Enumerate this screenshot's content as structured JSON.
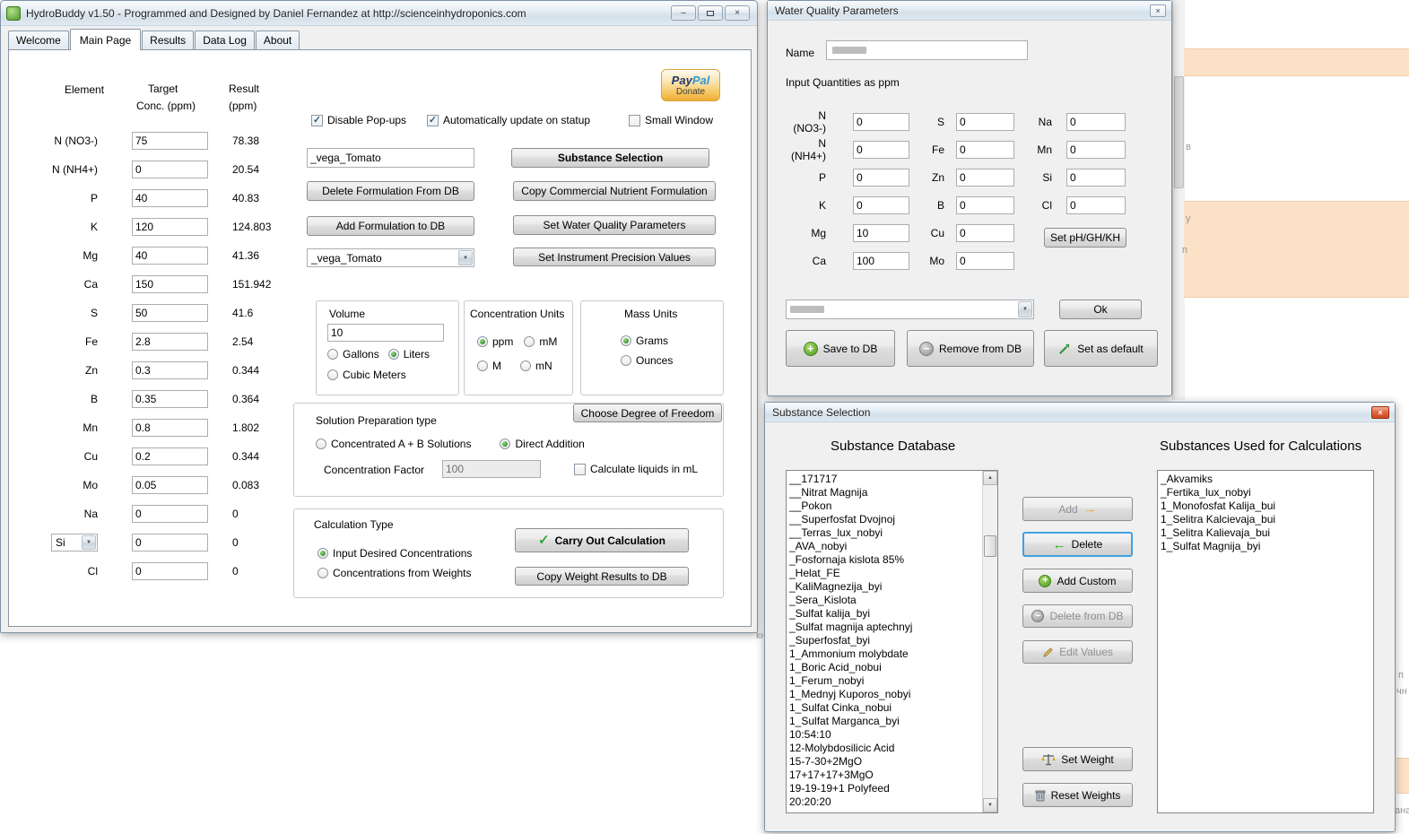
{
  "background": {
    "fragments": [
      {
        "text": "в"
      },
      {
        "text": "у"
      },
      {
        "text": "п"
      },
      {
        "text": "кно"
      },
      {
        "text": "п"
      },
      {
        "text": "чн"
      },
      {
        "text": "ана"
      }
    ]
  },
  "main_window": {
    "title": "HydroBuddy v1.50 - Programmed and Designed by Daniel Fernandez at http://scienceinhydroponics.com",
    "tabs": [
      {
        "label": "Welcome",
        "active": false
      },
      {
        "label": "Main Page",
        "active": true
      },
      {
        "label": "Results",
        "active": false
      },
      {
        "label": "Data Log",
        "active": false
      },
      {
        "label": "About",
        "active": false
      }
    ],
    "table": {
      "col_element": "Element",
      "col_target_line1": "Target",
      "col_target_line2": "Conc. (ppm)",
      "col_result_line1": "Result",
      "col_result_line2": "(ppm)",
      "rows": [
        {
          "element": "N (NO3-)",
          "target": "75",
          "result": "78.38"
        },
        {
          "element": "N (NH4+)",
          "target": "0",
          "result": "20.54"
        },
        {
          "element": "P",
          "target": "40",
          "result": "40.83"
        },
        {
          "element": "K",
          "target": "120",
          "result": "124.803"
        },
        {
          "element": "Mg",
          "target": "40",
          "result": "41.36"
        },
        {
          "element": "Ca",
          "target": "150",
          "result": "151.942"
        },
        {
          "element": "S",
          "target": "50",
          "result": "41.6"
        },
        {
          "element": "Fe",
          "target": "2.8",
          "result": "2.54"
        },
        {
          "element": "Zn",
          "target": "0.3",
          "result": "0.344"
        },
        {
          "element": "B",
          "target": "0.35",
          "result": "0.364"
        },
        {
          "element": "Mn",
          "target": "0.8",
          "result": "1.802"
        },
        {
          "element": "Cu",
          "target": "0.2",
          "result": "0.344"
        },
        {
          "element": "Mo",
          "target": "0.05",
          "result": "0.083"
        },
        {
          "element": "Na",
          "target": "0",
          "result": "0"
        },
        {
          "element": "Si",
          "target": "0",
          "result": "0",
          "si_select": true
        },
        {
          "element": "Cl",
          "target": "0",
          "result": "0"
        }
      ]
    },
    "options": {
      "disable_popups": {
        "label": "Disable Pop-ups",
        "checked": true
      },
      "auto_update": {
        "label": "Automatically update on statup",
        "checked": true
      },
      "small_window": {
        "label": "Small Window",
        "checked": false
      }
    },
    "formulation_name_input": "_vega_Tomato",
    "formulation_dropdown_value": "_vega_Tomato",
    "buttons": {
      "substance_selection": "Substance Selection",
      "delete_formulation": "Delete Formulation From DB",
      "copy_commercial": "Copy Commercial Nutrient Formulation",
      "add_formulation": "Add Formulation to DB",
      "set_water_quality": "Set Water Quality Parameters",
      "set_instrument": "Set Instrument Precision Values",
      "choose_degree": "Choose Degree of Freedom",
      "carry_out": "Carry Out Calculation",
      "copy_weights": "Copy Weight Results to DB"
    },
    "paypal": {
      "brand_pay": "Pay",
      "brand_pal": "Pal",
      "label": "Donate"
    },
    "volume": {
      "title": "Volume",
      "value": "10",
      "options": [
        {
          "label": "Gallons",
          "selected": false
        },
        {
          "label": "Liters",
          "selected": true
        },
        {
          "label": "Cubic Meters",
          "selected": false
        }
      ]
    },
    "concentration_units": {
      "title": "Concentration Units",
      "options": [
        {
          "label": "ppm",
          "selected": true
        },
        {
          "label": "mM",
          "selected": false
        },
        {
          "label": "M",
          "selected": false
        },
        {
          "label": "mN",
          "selected": false
        }
      ]
    },
    "mass_units": {
      "title": "Mass Units",
      "options": [
        {
          "label": "Grams",
          "selected": true
        },
        {
          "label": "Ounces",
          "selected": false
        }
      ]
    },
    "solution_prep": {
      "title": "Solution Preparation type",
      "options": [
        {
          "label": "Concentrated A + B Solutions",
          "selected": false
        },
        {
          "label": "Direct Addition",
          "selected": true
        }
      ],
      "concentration_factor_label": "Concentration Factor",
      "concentration_factor_value": "100",
      "calc_liquids": {
        "label": "Calculate liquids in mL",
        "checked": false
      }
    },
    "calculation_type": {
      "title": "Calculation Type",
      "options": [
        {
          "label": "Input Desired Concentrations",
          "selected": true
        },
        {
          "label": "Concentrations from Weights",
          "selected": false
        }
      ]
    }
  },
  "water_quality_window": {
    "title": "Water Quality Parameters",
    "name_label": "Name",
    "subtitle": "Input Quantities as ppm",
    "col1": [
      {
        "label": "N (NO3-)",
        "value": "0"
      },
      {
        "label": "N (NH4+)",
        "value": "0"
      },
      {
        "label": "P",
        "value": "0"
      },
      {
        "label": "K",
        "value": "0"
      },
      {
        "label": "Mg",
        "value": "10"
      },
      {
        "label": "Ca",
        "value": "100"
      }
    ],
    "col2": [
      {
        "label": "S",
        "value": "0"
      },
      {
        "label": "Fe",
        "value": "0"
      },
      {
        "label": "Zn",
        "value": "0"
      },
      {
        "label": "B",
        "value": "0"
      },
      {
        "label": "Cu",
        "value": "0"
      },
      {
        "label": "Mo",
        "value": "0"
      }
    ],
    "col3": [
      {
        "label": "Na",
        "value": "0"
      },
      {
        "label": "Mn",
        "value": "0"
      },
      {
        "label": "Si",
        "value": "0"
      },
      {
        "label": "Cl",
        "value": "0"
      }
    ],
    "buttons": {
      "set_ph": "Set pH/GH/KH",
      "ok": "Ok",
      "save": "Save to DB",
      "remove": "Remove from  DB",
      "set_default": "Set as default"
    }
  },
  "substance_window": {
    "title": "Substance Selection",
    "database_heading": "Substance Database",
    "used_heading": "Substances Used for Calculations",
    "database_items": [
      "__171717",
      "__Nitrat Magnija",
      "__Pokon",
      "__Superfosfat Dvojnoj",
      "__Terras_lux_nobyi",
      "_AVA_nobyi",
      "_Fosfornaja kislota 85%",
      "_Helat_FE",
      "_KaliMagnezija_byi",
      "_Sera_Kislota",
      "_Sulfat kalija_byi",
      "_Sulfat magnija aptechnyj",
      "_Superfosfat_byi",
      "1_Ammonium molybdate",
      "1_Boric Acid_nobui",
      "1_Ferum_nobyi",
      "1_Mednyj Kuporos_nobyi",
      "1_Sulfat Cinka_nobui",
      "1_Sulfat Marganca_byi",
      "10:54:10",
      "12-Molybdosilicic Acid",
      "15-7-30+2MgO",
      "17+17+17+3MgO",
      "19-19-19+1 Polyfeed",
      "20:20:20"
    ],
    "used_items": [
      "_Akvamiks",
      "_Fertika_lux_nobyi",
      "1_Monofosfat Kalija_bui",
      "1_Selitra Kalcievaja_bui",
      "1_Selitra Kalievaja_bui",
      "1_Sulfat Magnija_byi"
    ],
    "buttons": {
      "add": "Add",
      "delete": "Delete",
      "add_custom": "Add Custom",
      "delete_from_db": "Delete from DB",
      "edit_values": "Edit Values",
      "set_weight": "Set Weight",
      "reset_weights": "Reset Weights"
    }
  }
}
